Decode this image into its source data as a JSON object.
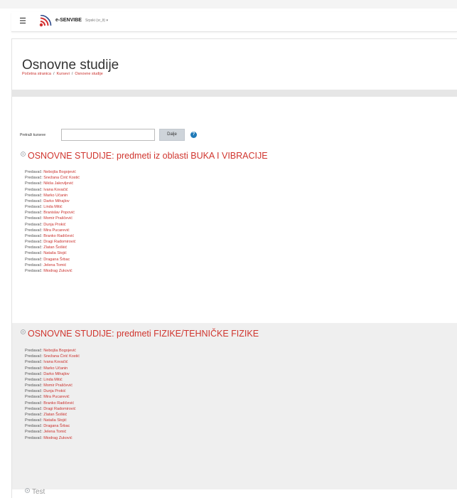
{
  "navbar": {
    "menu_icon": "hamburger-icon",
    "brand": "e-SENVIBE",
    "language": "Srpski (sr_lt) ▾"
  },
  "header": {
    "title": "Osnovne studije",
    "breadcrumb": [
      "Početna stranica",
      "Kursevi",
      "Osnovne studije"
    ]
  },
  "search": {
    "label": "Pretraži kurseve",
    "value": "",
    "button": "Dalje",
    "help_icon": "question-circle-icon"
  },
  "categories": [
    {
      "title": "OSNOVNE STUDIJE: predmeti iz oblasti BUKA I VIBRACIJE",
      "teacher_label": "Predavač:",
      "teachers": [
        "Nebojša Bogojević",
        "Snežana Ćirić Kostić",
        "Nikša Jakovljević",
        "Ivana Kovačić",
        "Marko Učanin",
        "Darko Mihajlov",
        "Linda Mitić",
        "Branislav Popović",
        "Momir Praščević",
        "Dunja Prokić",
        "Mira Pucarević",
        "Branko Radičević",
        "Dragi Radomirović",
        "Zlatan Šoškić",
        "Nataša Stojić",
        "Dragana Šrbac",
        "Jelena Tomić",
        "Miodrag Zuković"
      ]
    },
    {
      "title": "OSNOVNE STUDIJE: predmeti FIZIKE/TEHNIČKE FIZIKE",
      "teacher_label": "Predavač:",
      "teachers": [
        "Nebojša Bogojević",
        "Snežana Ćirić Kostić",
        "Ivana Kovačić",
        "Marko Učanin",
        "Darko Mihajlov",
        "Linda Mitić",
        "Momir Praščević",
        "Dunja Prokić",
        "Mira Pucarević",
        "Branko Radičević",
        "Dragi Radomirović",
        "Zlatan Šoškić",
        "Nataša Stojić",
        "Dragana Šrbac",
        "Jelena Tomić",
        "Miodrag Zuković"
      ]
    }
  ],
  "extra_category": "Test",
  "colors": {
    "link_red": "#d0352e",
    "help_blue": "#1f7ab8",
    "button_grey": "#ced4da",
    "logo_red": "#d32f2f"
  }
}
